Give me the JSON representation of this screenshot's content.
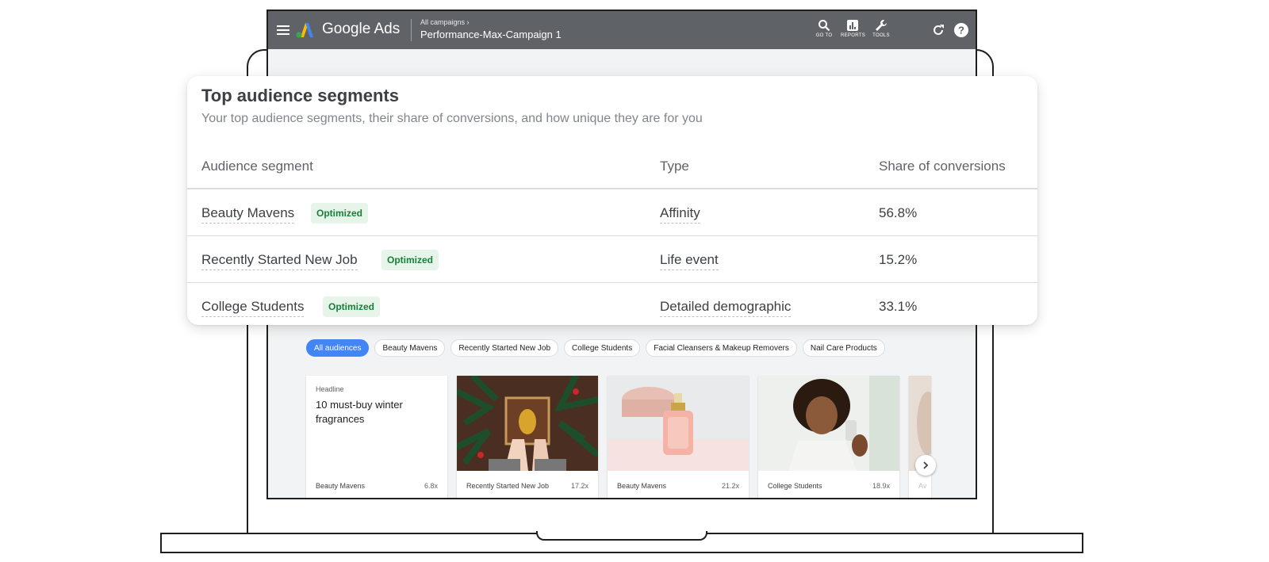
{
  "app": {
    "brand": "Google Ads",
    "breadcrumb": "All campaigns",
    "campaign_name": "Performance-Max-Campaign 1",
    "tools": [
      {
        "label": "GO TO",
        "icon": "search-icon"
      },
      {
        "label": "REPORTS",
        "icon": "reports-icon"
      },
      {
        "label": "TOOLS",
        "icon": "wrench-icon"
      }
    ],
    "extra_icons": [
      "refresh-icon",
      "help-icon"
    ]
  },
  "panel": {
    "title": "Top audience segments",
    "subtitle": "Your top audience segments, their share of conversions, and how unique they are for you",
    "columns": [
      "Audience segment",
      "Type",
      "Share of conversions"
    ],
    "rows": [
      {
        "segment": "Beauty Mavens",
        "badge": "Optimized",
        "type": "Affinity",
        "share": "56.8%"
      },
      {
        "segment": "Recently Started New Job",
        "badge": "Optimized",
        "type": "Life event",
        "share": "15.2%"
      },
      {
        "segment": "College Students",
        "badge": "Optimized",
        "type": "Detailed demographic",
        "share": "33.1%"
      }
    ]
  },
  "chips": [
    "All audiences",
    "Beauty Mavens",
    "Recently Started New Job",
    "College Students",
    "Facial Cleansers & Makeup Removers",
    "Nail Care Products"
  ],
  "active_chip": "All audiences",
  "cards": [
    {
      "label": "Headline",
      "headline": "10 must-buy winter fragrances",
      "segment": "Beauty Mavens",
      "multiplier": "6.8x"
    },
    {
      "image": "gift-box-evergreen",
      "segment": "Recently Started New Job",
      "multiplier": "17.2x"
    },
    {
      "image": "perfume-bottle",
      "segment": "Beauty Mavens",
      "multiplier": "21.2x"
    },
    {
      "image": "woman-with-perfume",
      "segment": "College Students",
      "multiplier": "18.9x"
    }
  ],
  "partial_card_text": "Av",
  "colors": {
    "topbar": "#5f6368",
    "accent_blue": "#4285f4",
    "badge_bg": "#e6f4ea",
    "badge_text": "#188038"
  }
}
